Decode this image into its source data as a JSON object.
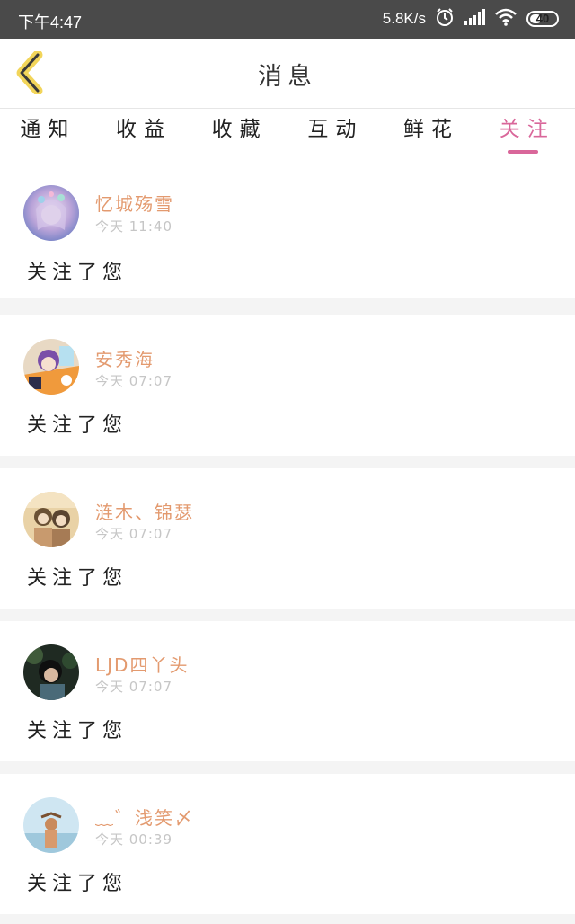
{
  "status_bar": {
    "time": "下午4:47",
    "network_speed": "5.8K/s",
    "battery_level": "40",
    "icons": [
      "alarm-icon",
      "signal-icon",
      "wifi-icon",
      "battery-icon"
    ]
  },
  "header": {
    "title": "消息",
    "back_icon": "chevron-left-icon",
    "accent_color": "#f2d55a"
  },
  "tabs": [
    {
      "label": "通知",
      "active": false
    },
    {
      "label": "收益",
      "active": false
    },
    {
      "label": "收藏",
      "active": false
    },
    {
      "label": "互动",
      "active": false
    },
    {
      "label": "鲜花",
      "active": false
    },
    {
      "label": "关注",
      "active": true
    }
  ],
  "colors": {
    "active_tab": "#d9679a",
    "username": "#e39a6f",
    "timestamp": "#c6c6c6"
  },
  "notifications": [
    {
      "name": "忆城殇雪",
      "time": "今天 11:40",
      "message": "关注了您"
    },
    {
      "name": "安秀海",
      "time": "今天 07:07",
      "message": "关注了您"
    },
    {
      "name": "涟木、锦瑟",
      "time": "今天 07:07",
      "message": "关注了您"
    },
    {
      "name": "LJD四丫头",
      "time": "今天 07:07",
      "message": "关注了您"
    },
    {
      "name": "﹏゛浅笑〆",
      "time": "今天 00:39",
      "message": "关注了您"
    }
  ]
}
